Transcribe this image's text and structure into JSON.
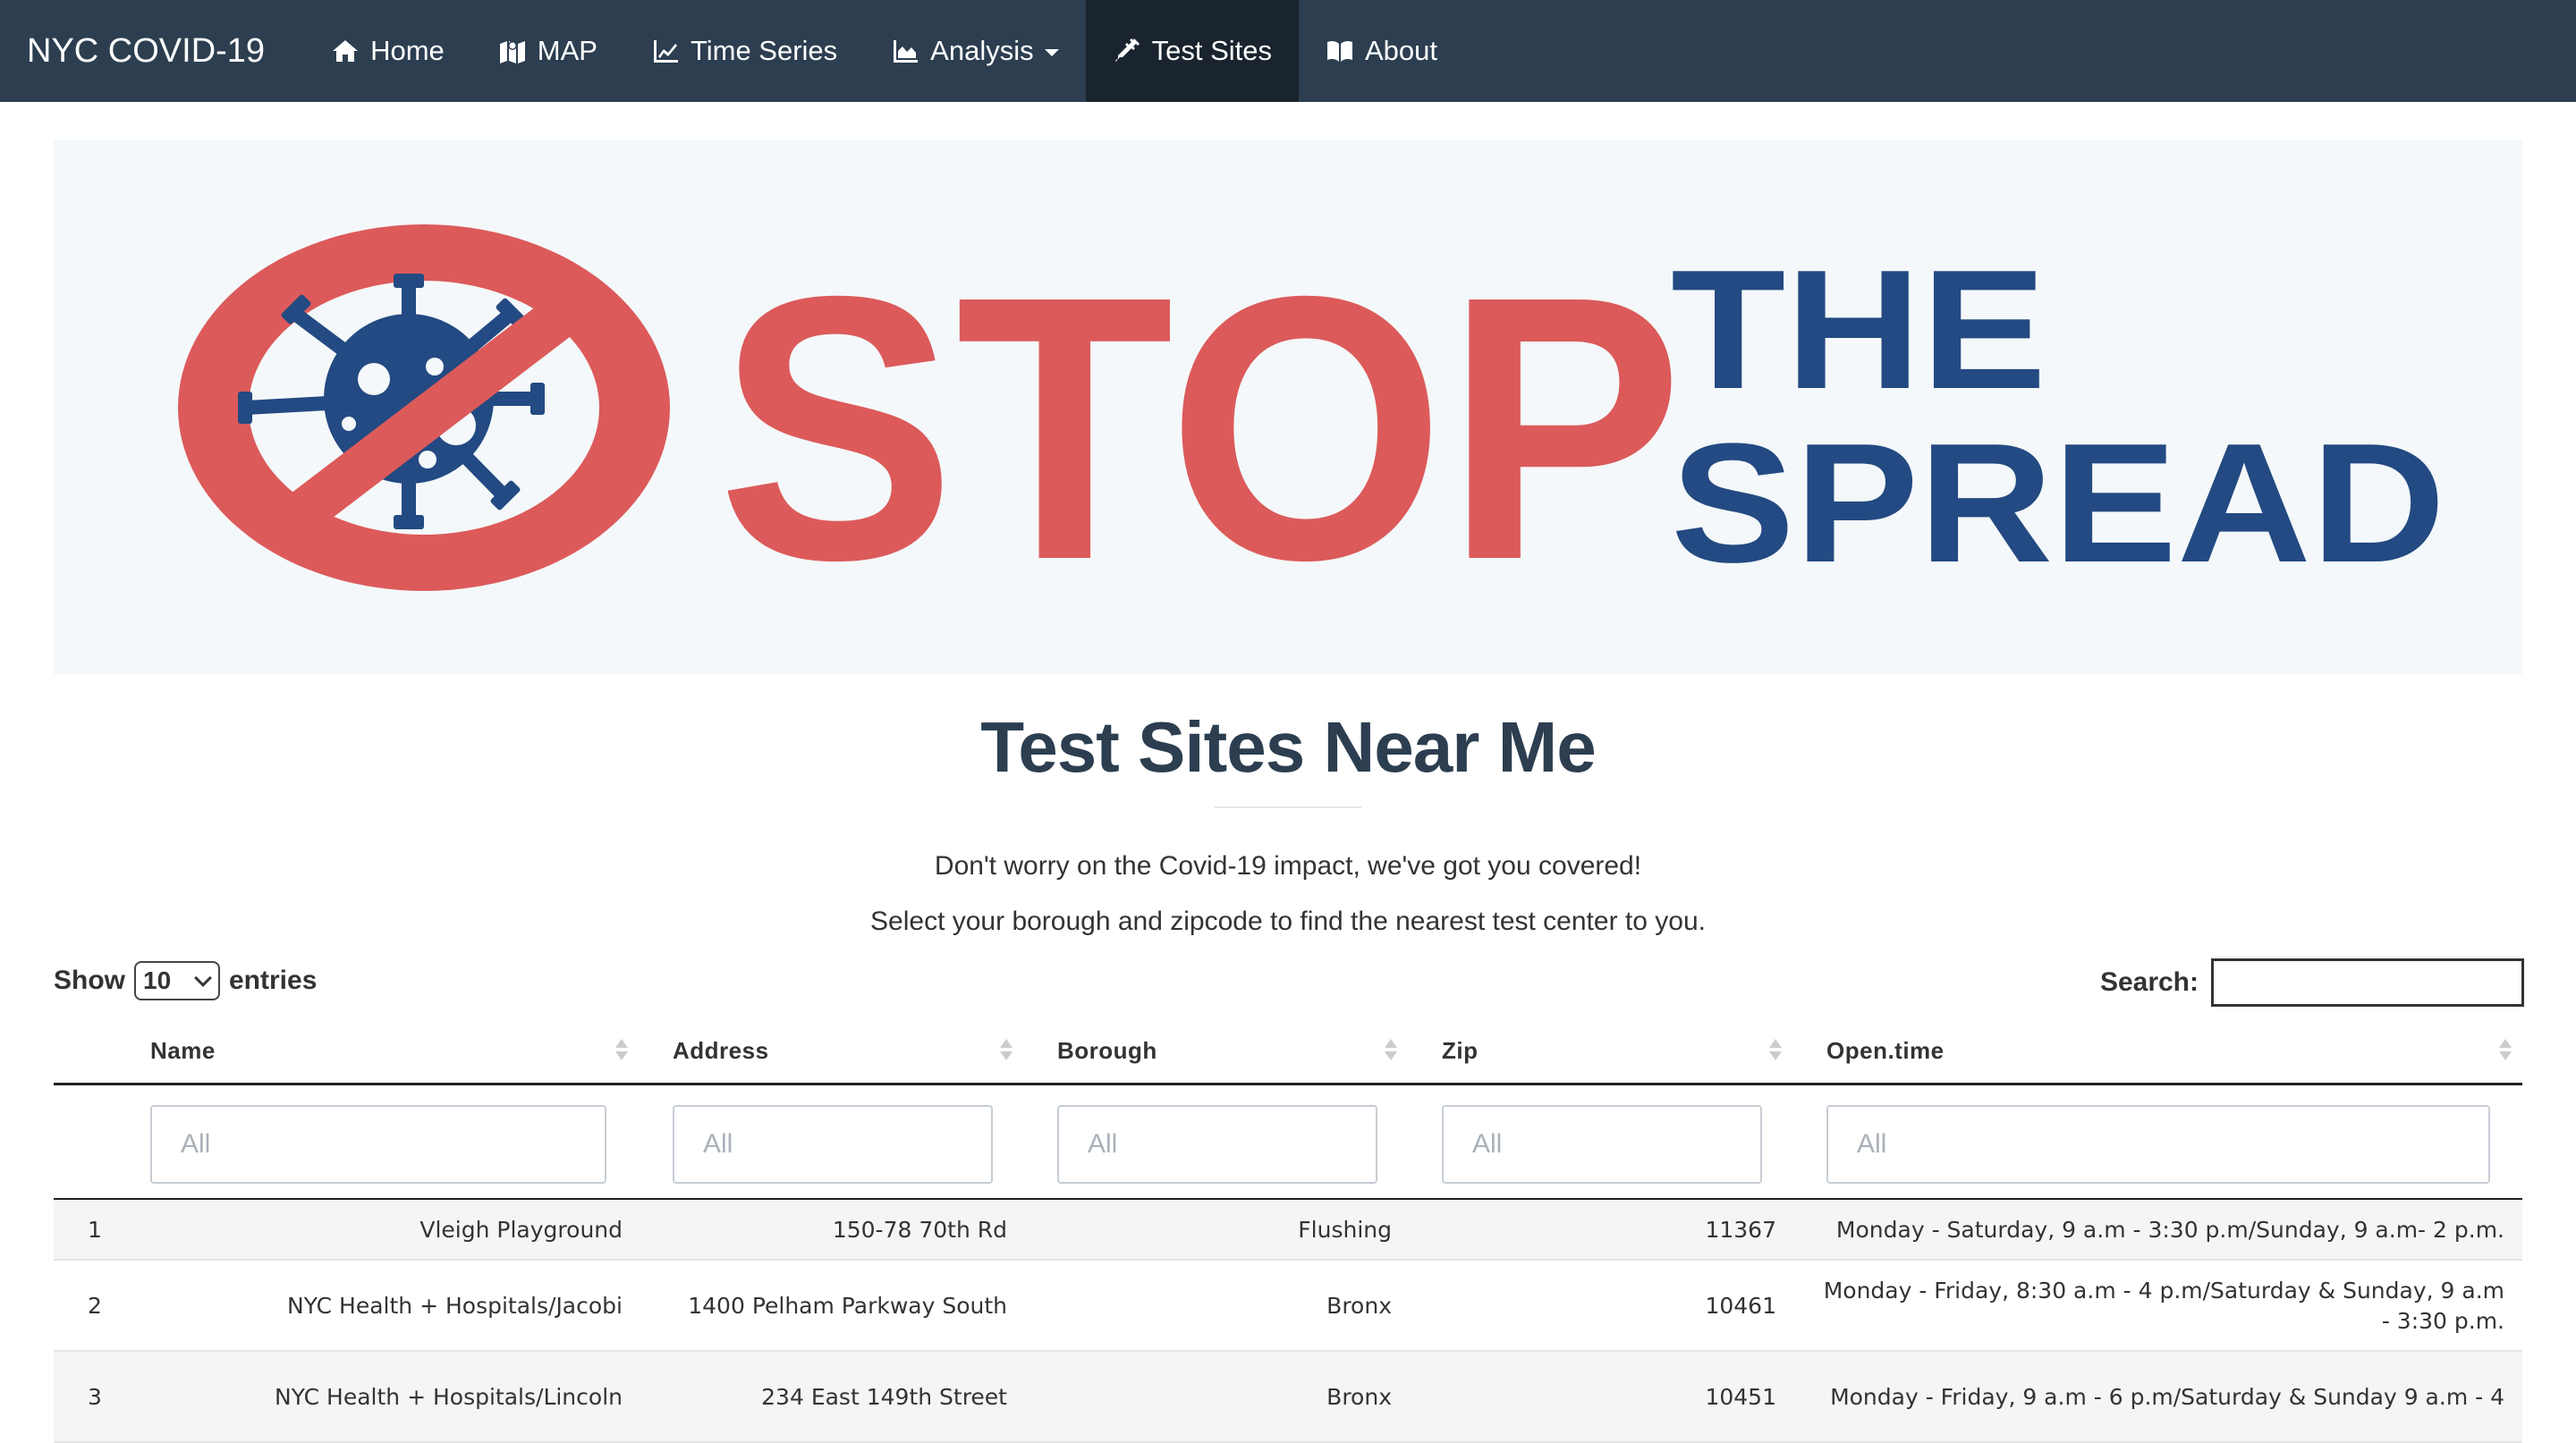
{
  "navbar": {
    "brand": "NYC COVID-19",
    "items": [
      {
        "label": "Home",
        "icon": "home-icon"
      },
      {
        "label": "MAP",
        "icon": "map-icon"
      },
      {
        "label": "Time Series",
        "icon": "line-chart-icon"
      },
      {
        "label": "Analysis",
        "icon": "area-chart-icon",
        "dropdown": true
      },
      {
        "label": "Test Sites",
        "icon": "syringe-icon",
        "active": true
      },
      {
        "label": "About",
        "icon": "book-icon"
      }
    ]
  },
  "banner": {
    "word_stop": "STOP",
    "word_the": "THE",
    "word_spread": "SPREAD",
    "colors": {
      "red": "#dc5a5a",
      "blue": "#234a82",
      "background": "#f4f8fa"
    }
  },
  "page": {
    "title": "Test Sites Near Me",
    "intro_line1": "Don't worry on the Covid-19 impact, we've got you covered!",
    "intro_line2": "Select your borough and zipcode to find the nearest test center to you."
  },
  "table_controls": {
    "show_label": "Show",
    "entries_value": "10",
    "entries_label": "entries",
    "search_label": "Search:",
    "search_value": ""
  },
  "table": {
    "columns": [
      "Name",
      "Address",
      "Borough",
      "Zip",
      "Open.time"
    ],
    "filter_placeholder": "All",
    "rows": [
      {
        "idx": "1",
        "name": "Vleigh Playground",
        "address": "150-78 70th Rd",
        "borough": "Flushing",
        "zip": "11367",
        "open_time": "Monday - Saturday, 9 a.m - 3:30 p.m/Sunday, 9 a.m- 2 p.m."
      },
      {
        "idx": "2",
        "name": "NYC Health + Hospitals/Jacobi",
        "address": "1400 Pelham Parkway South",
        "borough": "Bronx",
        "zip": "10461",
        "open_time": "Monday - Friday, 8:30 a.m - 4 p.m/Saturday & Sunday, 9 a.m - 3:30 p.m."
      },
      {
        "idx": "3",
        "name": "NYC Health + Hospitals/Lincoln",
        "address": "234 East 149th Street",
        "borough": "Bronx",
        "zip": "10451",
        "open_time": "Monday - Friday, 9 a.m - 6 p.m/Saturday & Sunday 9 a.m - 4"
      }
    ]
  }
}
